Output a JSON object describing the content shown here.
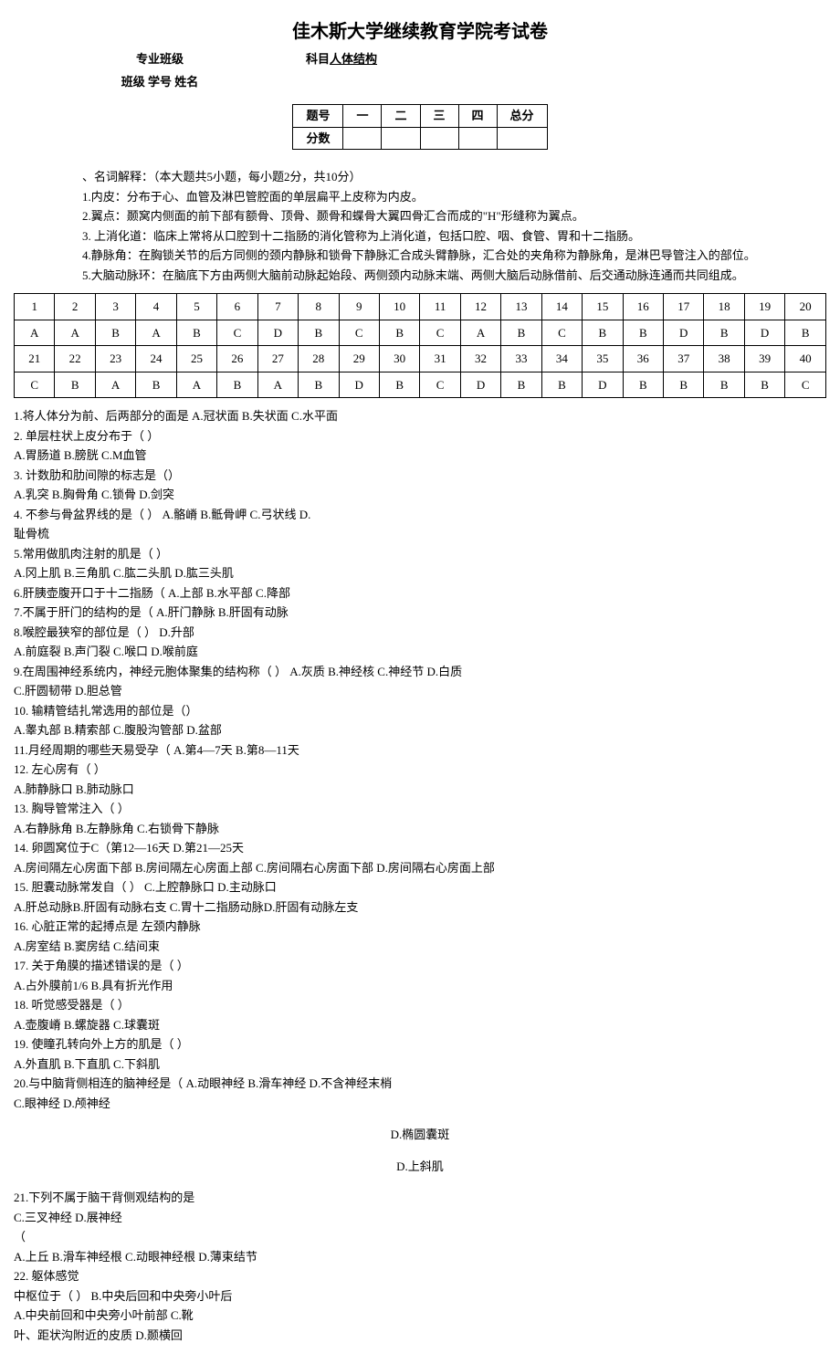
{
  "title": "佳木斯大学继续教育学院考试卷",
  "header": {
    "major": "专业班级",
    "subject_label": "科目",
    "subject": "人体结构",
    "class_line": "班级 学号 姓名"
  },
  "score_table": {
    "row1": [
      "题号",
      "一",
      "二",
      "三",
      "四",
      "总分"
    ],
    "row2_label": "分数"
  },
  "definitions": {
    "intro": "、名词解释：（本大题共5小题，每小题2分，共10分）",
    "d1": "1.内皮：分布于心、血管及淋巴管腔面的单层扁平上皮称为内皮。",
    "d2": "2.翼点：颞窝内侧面的前下部有额骨、顶骨、颞骨和蝶骨大翼四骨汇合而成的\"H\"形缝称为翼点。",
    "d3": "3. 上消化道：临床上常将从口腔到十二指肠的消化管称为上消化道，包括口腔、咽、食管、胃和十二指肠。",
    "d4": "4.静脉角：在胸锁关节的后方同侧的颈内静脉和锁骨下静脉汇合成头臂静脉，汇合处的夹角称为静脉角，是淋巴导管注入的部位。",
    "d5": "5.大脑动脉环：在脑底下方由两侧大脑前动脉起始段、两侧颈内动脉末端、两侧大脑后动脉借前、后交通动脉连通而共同组成。"
  },
  "answer_table": {
    "r1": [
      "1",
      "2",
      "3",
      "4",
      "5",
      "6",
      "7",
      "8",
      "9",
      "10",
      "11",
      "12",
      "13",
      "14",
      "15",
      "16",
      "17",
      "18",
      "19",
      "20"
    ],
    "r2": [
      "A",
      "A",
      "B",
      "A",
      "B",
      "C",
      "D",
      "B",
      "C",
      "B",
      "C",
      "A",
      "B",
      "C",
      "B",
      "B",
      "D",
      "B",
      "D",
      "B"
    ],
    "r3": [
      "21",
      "22",
      "23",
      "24",
      "25",
      "26",
      "27",
      "28",
      "29",
      "30",
      "31",
      "32",
      "33",
      "34",
      "35",
      "36",
      "37",
      "38",
      "39",
      "40"
    ],
    "r4": [
      "C",
      "B",
      "A",
      "B",
      "A",
      "B",
      "A",
      "B",
      "D",
      "B",
      "C",
      "D",
      "B",
      "B",
      "D",
      "B",
      "B",
      "B",
      "B",
      "C"
    ]
  },
  "questions": {
    "q1": "1.将人体分为前、后两部分的面是 A.冠状面 B.失状面 C.水平面",
    "q2": "2.                        单层柱状上皮分布于（    ）",
    "q2a": "A.胃肠道 B.膀胱 C.M血管",
    "q3": "3.                             计数肋和肋间隙的标志是（）",
    "q3a": "A.乳突    B.胸骨角   C.锁骨    D.剑突",
    "q4": "4.                             不参与骨盆界线的是（    ） A.骼嵴 B.骶骨岬 C.弓状线 D.",
    "q4a": "耻骨梳",
    "q5": "5.常用做肌肉注射的肌是（  ）",
    "q5a": "A.冈上肌 B.三角肌 C.肱二头肌 D.肱三头肌",
    "q6": "6.肝胰壶腹开口于十二指肠（  A.上部 B.水平部 C.降部",
    "q7": "7.不属于肝门的结构的是（  A.肝门静脉 B.肝固有动脉",
    "q8": "8.喉腔最狭窄的部位是（      ） D.升部",
    "q8a": "A.前庭裂 B.声门裂 C.喉口 D.喉前庭",
    "q9": "9.在周围神经系统内，神经元胞体聚集的结构称（    ） A.灰质 B.神经核 C.神经节 D.白质",
    "q9b": "                          C.肝圆韧带 D.胆总管",
    "q10": "10.  输精管结扎常选用的部位是（）",
    "q10a": "A.睾丸部 B.精索部 C.腹股沟管部         D.盆部",
    "q11": "11.月经周期的哪些天易受孕（  A.第4—7天 B.第8—11天",
    "q12": "12.             左心房有（  ）",
    "q12a": "A.肺静脉口    B.肺动脉口",
    "q13": "13.                  胸导管常注入（  ）",
    "q13a": "A.右静脉角  B.左静脉角   C.右锁骨下静脉",
    "q14": "14.                  卵圆窝位于C（第12—16天     D.第21—25天",
    "q14a": "A.房间隔左心房面下部 B.房间隔左心房面上部 C.房间隔右心房面下部 D.房间隔右心房面上部",
    "q15": "15. 胆囊动脉常发自（  ）      C.上腔静脉口    D.主动脉口",
    "q15a": "A.肝总动脉B.肝固有动脉右支 C.胃十二指肠动脉D.肝固有动脉左支",
    "q16": "16.                        心脏正常的起搏点是 左颈内静脉",
    "q16a": "A.房室结 B.窦房结 C.结间束",
    "q17": "17.                          关于角膜的描述错误的是（    ）",
    "q17a": "A.占外膜前1/6 B.具有折光作用",
    "q18": "18.                  听觉感受器是（  ）",
    "q18a": "A.壶腹嵴 B.螺旋器 C.球囊斑",
    "q19": "19.                          使瞳孔转向外上方的肌是（    ）",
    "q19a": "A.外直肌 B.下直肌 C.下斜肌",
    "q20": "20.与中脑背侧相连的脑神经是（  A.动眼神经 B.滑车神经   D.不含神经末梢",
    "q20c": "                                 C.眼神经 D.颅神经",
    "q20d": "D.椭圆囊斑",
    "q20e": "D.上斜肌",
    "q21": "21.下列不属于脑干背侧观结构的是",
    "q21b": "                         C.三叉神经     D.展神经",
    "q21p": "（",
    "q21a": "A.上丘     B.滑车神经根   C.动眼神经根 D.薄束结节",
    "q22": "22.                 躯体感觉",
    "q22a": "中枢位于（      ）           B.中央后回和中央旁小叶后",
    "q22b": "A.中央前回和中央旁小叶前部 C.靴",
    "q22c": "叶、距状沟附近的皮质       D.颞横回"
  }
}
